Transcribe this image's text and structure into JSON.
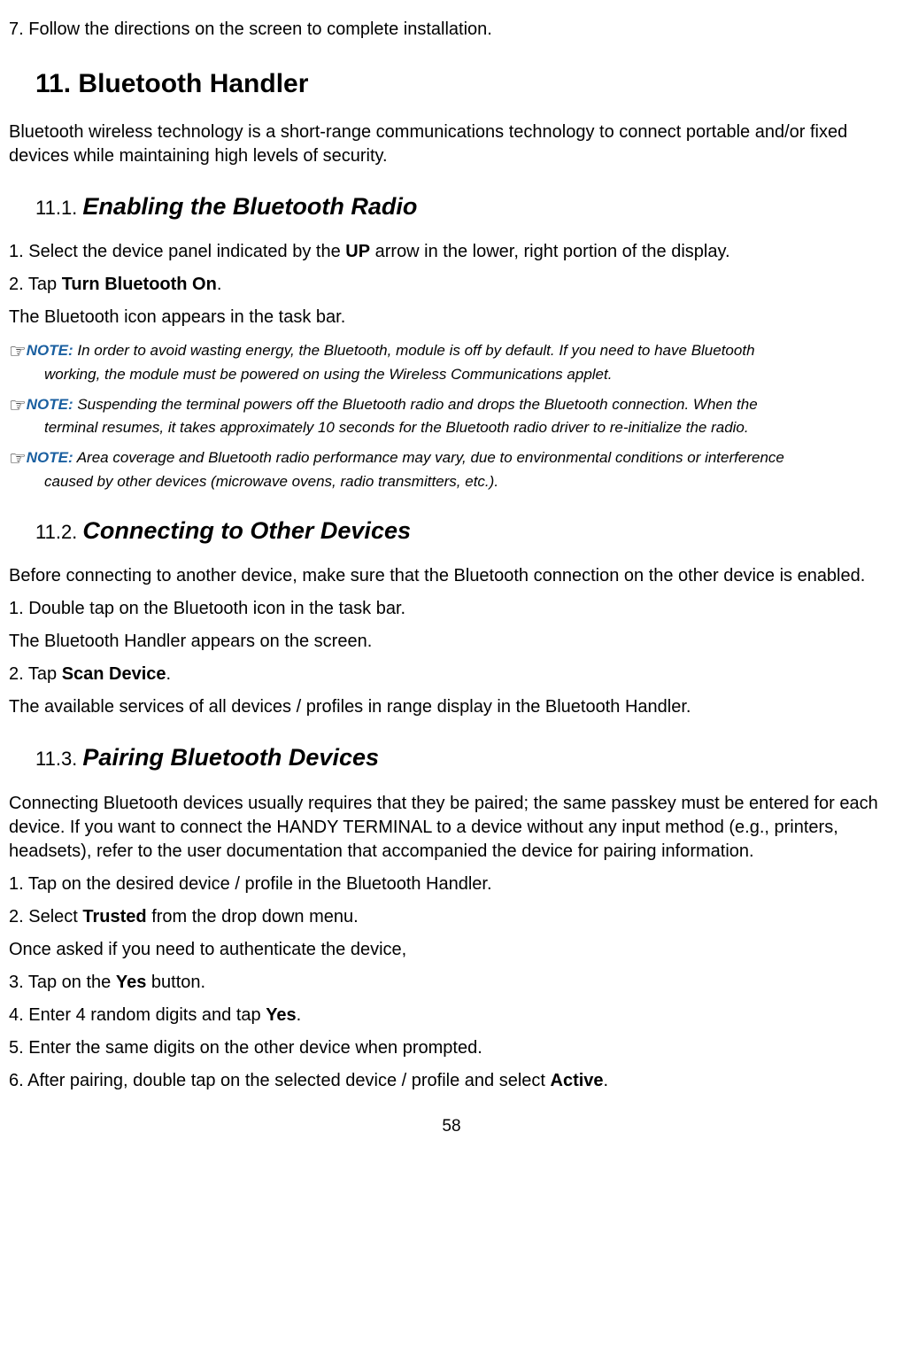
{
  "step7": "7. Follow the directions on the screen to complete installation.",
  "h1_num": "11.",
  "h1_title": " Bluetooth Handler",
  "intro": "Bluetooth wireless technology is a short-range communications technology to connect portable and/or fixed devices while maintaining high levels of security.",
  "s11_1": {
    "num": "11.1. ",
    "title": "Enabling the Bluetooth Radio",
    "p1_a": "1. Select the device panel indicated by the ",
    "p1_b": "UP",
    "p1_c": " arrow in the lower, right portion of the display.",
    "p2_a": "2. Tap ",
    "p2_b": "Turn Bluetooth On",
    "p2_c": ".",
    "p3": "The Bluetooth icon appears in the task bar.",
    "note1_label": "NOTE:",
    "note1_text": " In order to avoid wasting energy, the Bluetooth, module is off by default. If you need to have Bluetooth",
    "note1_cont": "working, the module must be powered on using the Wireless Communications applet.",
    "note2_label": "NOTE:",
    "note2_text": " Suspending the terminal powers off the Bluetooth radio and drops the Bluetooth connection. When the",
    "note2_cont": "terminal resumes, it takes approximately 10 seconds for the Bluetooth radio driver to re-initialize the radio.",
    "note3_label": "NOTE:",
    "note3_text": " Area coverage and Bluetooth radio performance may vary, due to environmental conditions or interference",
    "note3_cont": "caused by other devices (microwave ovens, radio transmitters, etc.)."
  },
  "s11_2": {
    "num": "11.2. ",
    "title": "Connecting to Other Devices",
    "p1": "Before connecting to another device, make sure that the Bluetooth connection on the other device is enabled.",
    "p2": "1. Double tap on the Bluetooth icon in the task bar.",
    "p3": "The Bluetooth Handler appears on the screen.",
    "p4_a": "2. Tap ",
    "p4_b": "Scan Device",
    "p4_c": ".",
    "p5": "The available services of all devices / profiles in range display in the Bluetooth Handler."
  },
  "s11_3": {
    "num": "11.3. ",
    "title": "Pairing Bluetooth Devices",
    "p1": "Connecting Bluetooth devices usually requires that they be paired; the same passkey must be entered for each device. If you want to connect the HANDY TERMINAL to a device without any input method (e.g., printers, headsets), refer to the user documentation that accompanied the device for pairing information.",
    "p2": "1. Tap on the desired device / profile in the Bluetooth Handler.",
    "p3_a": "2. Select ",
    "p3_b": "Trusted",
    "p3_c": " from the drop down menu.",
    "p4": "Once asked if you need to authenticate the device,",
    "p5_a": "3. Tap on the ",
    "p5_b": "Yes",
    "p5_c": " button.",
    "p6_a": "4. Enter 4 random digits and tap ",
    "p6_b": "Yes",
    "p6_c": ".",
    "p7": "5. Enter the same digits on the other device when prompted.",
    "p8_a": "6. After pairing, double tap on the selected device / profile and select ",
    "p8_b": "Active",
    "p8_c": "."
  },
  "page_number": "58",
  "pointer_glyph": "☞"
}
